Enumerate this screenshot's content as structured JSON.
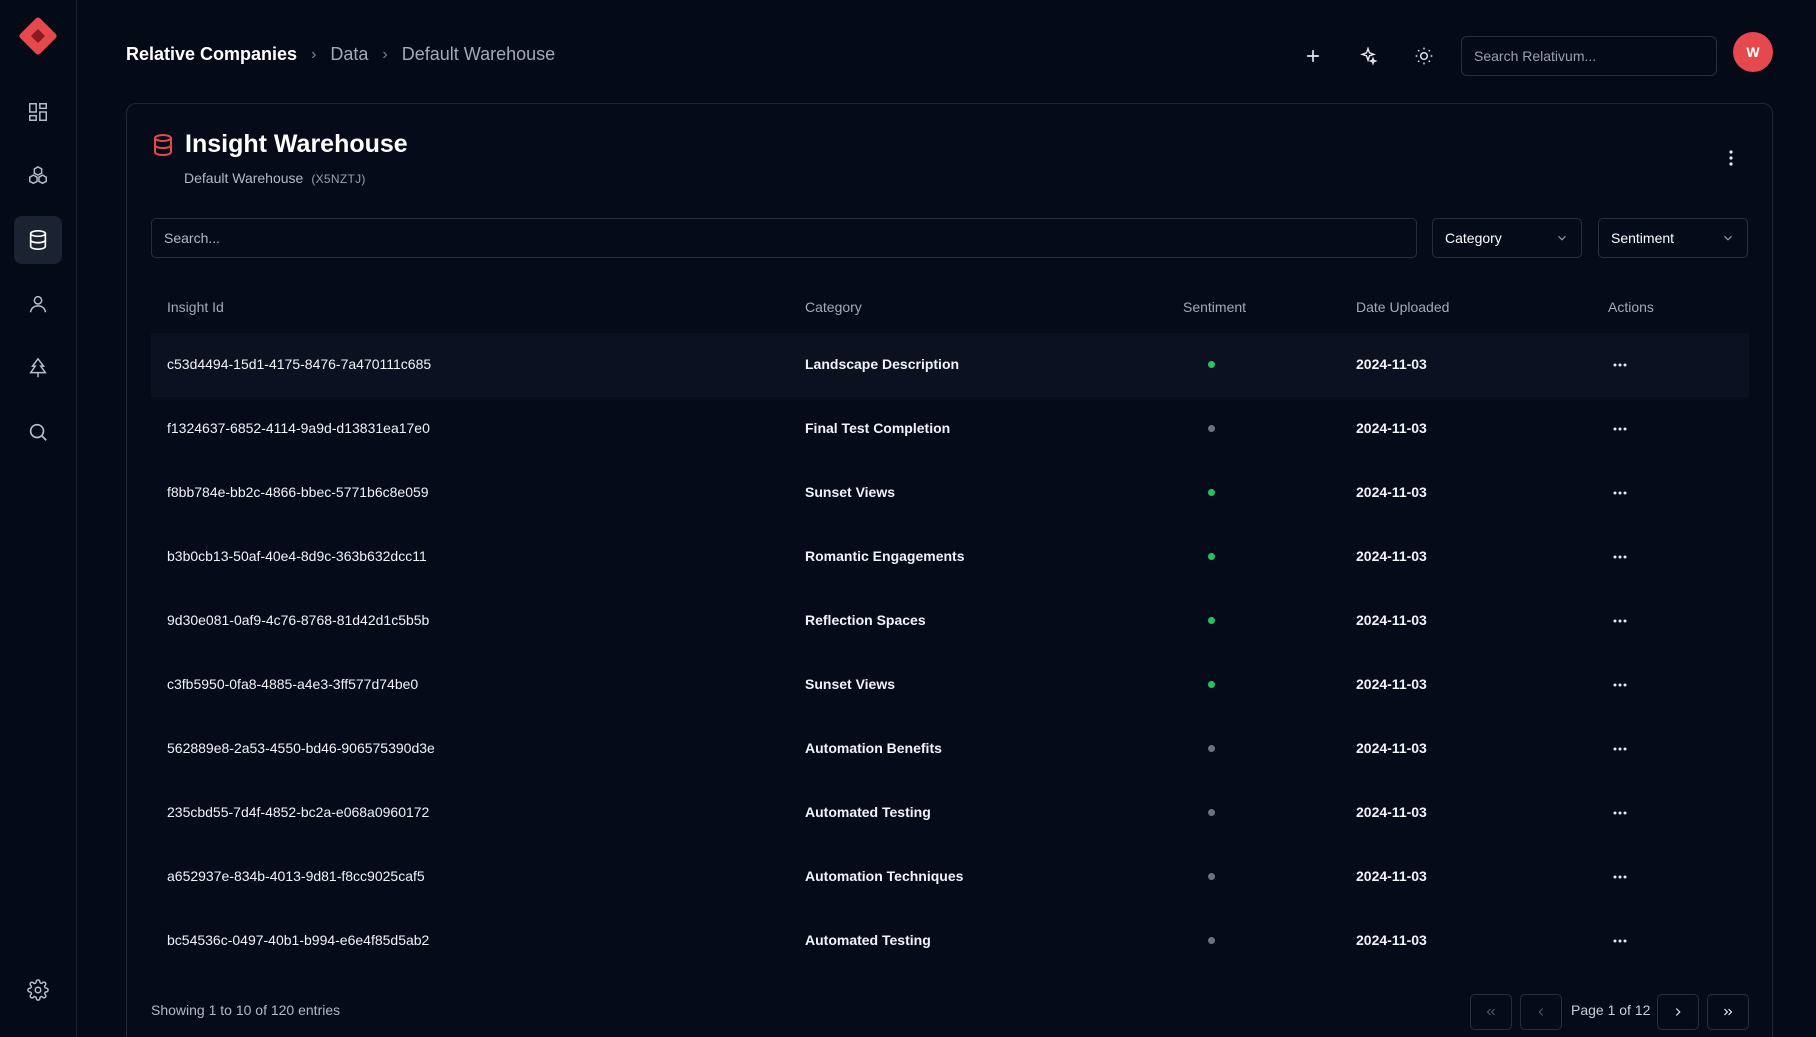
{
  "sidebar": {
    "items": [
      {
        "name": "dashboard",
        "icon": "dashboard-icon"
      },
      {
        "name": "models",
        "icon": "cubes-icon"
      },
      {
        "name": "data",
        "icon": "database-icon",
        "active": true
      },
      {
        "name": "users",
        "icon": "user-icon"
      },
      {
        "name": "tree",
        "icon": "tree-icon"
      },
      {
        "name": "search",
        "icon": "search-icon"
      },
      {
        "name": "settings",
        "icon": "gear-icon"
      }
    ]
  },
  "header": {
    "breadcrumb": [
      "Relative Companies",
      "Data",
      "Default Warehouse"
    ],
    "search_placeholder": "Search Relativum...",
    "avatar_initial": "W"
  },
  "card": {
    "title": "Insight Warehouse",
    "subtitle": "Default Warehouse",
    "code": "(X5NZTJ)",
    "search_placeholder": "Search...",
    "filters": {
      "category": "Category",
      "sentiment": "Sentiment"
    }
  },
  "table": {
    "columns": [
      "Insight Id",
      "Category",
      "Sentiment",
      "Date Uploaded",
      "Actions"
    ],
    "rows": [
      {
        "id": "c53d4494-15d1-4175-8476-7a470111c685",
        "category": "Landscape Description",
        "sentiment": "positive",
        "date": "2024-11-03"
      },
      {
        "id": "f1324637-6852-4114-9a9d-d13831ea17e0",
        "category": "Final Test Completion",
        "sentiment": "neutral",
        "date": "2024-11-03"
      },
      {
        "id": "f8bb784e-bb2c-4866-bbec-5771b6c8e059",
        "category": "Sunset Views",
        "sentiment": "positive",
        "date": "2024-11-03"
      },
      {
        "id": "b3b0cb13-50af-40e4-8d9c-363b632dcc11",
        "category": "Romantic Engagements",
        "sentiment": "positive",
        "date": "2024-11-03"
      },
      {
        "id": "9d30e081-0af9-4c76-8768-81d42d1c5b5b",
        "category": "Reflection Spaces",
        "sentiment": "positive",
        "date": "2024-11-03"
      },
      {
        "id": "c3fb5950-0fa8-4885-a4e3-3ff577d74be0",
        "category": "Sunset Views",
        "sentiment": "positive",
        "date": "2024-11-03"
      },
      {
        "id": "562889e8-2a53-4550-bd46-906575390d3e",
        "category": "Automation Benefits",
        "sentiment": "neutral",
        "date": "2024-11-03"
      },
      {
        "id": "235cbd55-7d4f-4852-bc2a-e068a0960172",
        "category": "Automated Testing",
        "sentiment": "neutral",
        "date": "2024-11-03"
      },
      {
        "id": "a652937e-834b-4013-9d81-f8cc9025caf5",
        "category": "Automation Techniques",
        "sentiment": "neutral",
        "date": "2024-11-03"
      },
      {
        "id": "bc54536c-0497-40b1-b994-e6e4f85d5ab2",
        "category": "Automated Testing",
        "sentiment": "neutral",
        "date": "2024-11-03"
      }
    ]
  },
  "footer": {
    "showing": "Showing 1 to 10 of 120 entries",
    "page_label": "Page 1 of 12"
  },
  "colors": {
    "accent": "#e5484d",
    "positive": "#22c55e",
    "neutral": "#6b7280",
    "background": "#050a17"
  }
}
